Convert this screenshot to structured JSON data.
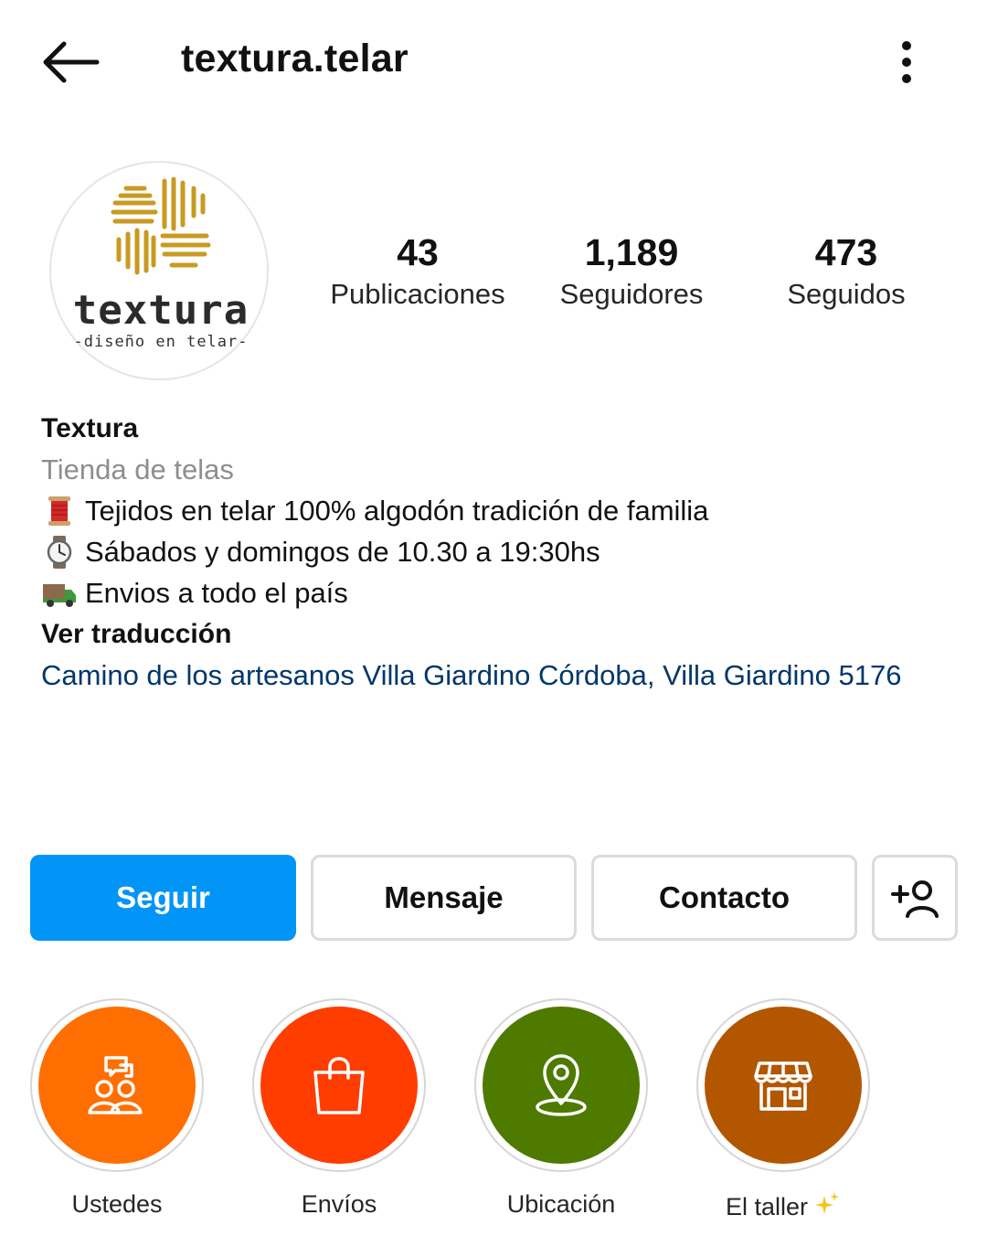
{
  "header": {
    "username": "textura.telar",
    "back_icon": "arrow-left-icon",
    "more_icon": "more-vertical-icon"
  },
  "avatar": {
    "word": "textura",
    "tagline": "-diseño en telar-",
    "accent": "#c99a22"
  },
  "stats": [
    {
      "value": "43",
      "label": "Publicaciones"
    },
    {
      "value": "1,189",
      "label": "Seguidores"
    },
    {
      "value": "473",
      "label": "Seguidos"
    }
  ],
  "bio": {
    "name": "Textura",
    "category": "Tienda de telas",
    "lines": [
      {
        "icon": "thread-spool-icon",
        "text": "Tejidos en telar 100% algodón tradición de familia"
      },
      {
        "icon": "watch-icon",
        "text": "Sábados y domingos de 10.30 a 19:30hs"
      },
      {
        "icon": "truck-icon",
        "text": "Envios a todo el país"
      }
    ],
    "translate": "Ver traducción",
    "address": "Camino de los artesanos Villa Giardino Córdoba, Villa Giardino 5176"
  },
  "buttons": {
    "follow": "Seguir",
    "message": "Mensaje",
    "contact": "Contacto",
    "add_user_icon": "add-person-icon"
  },
  "highlights": [
    {
      "label": "Ustedes",
      "color": "#ff6e00",
      "icon": "people-chat-icon"
    },
    {
      "label": "Envíos",
      "color": "#ff3d00",
      "icon": "shopping-bag-icon"
    },
    {
      "label": "Ubicación",
      "color": "#4e7a00",
      "icon": "location-pin-icon"
    },
    {
      "label": "El taller",
      "color": "#b35600",
      "icon": "storefront-icon",
      "extra_icon": "sparkles-icon"
    }
  ],
  "colors": {
    "primary": "#0095f6",
    "link": "#00376b",
    "muted": "#8e8e8e"
  }
}
